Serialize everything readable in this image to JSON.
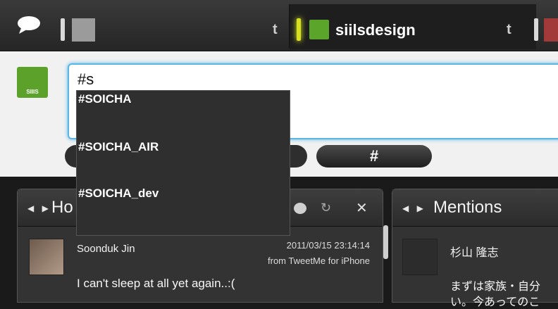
{
  "top": {
    "account_name": "siilsdesign",
    "twitter_glyph": "t",
    "icons": [
      "chat-icon",
      "twitter-icon"
    ]
  },
  "compose": {
    "logo_text": "SIIIS",
    "input_value": "#s",
    "hash_button": "#"
  },
  "autocomplete": {
    "items": [
      "#SOICHA",
      "#SOICHA_AIR",
      "#SOICHA_dev"
    ]
  },
  "home_panel": {
    "title": "Ho",
    "arrows": "◀ ▶",
    "refresh_icon": "↻",
    "close_icon": "✕",
    "tweet": {
      "user": "Soonduk Jin",
      "datetime": "2011/03/15 23:14:14",
      "source": "from TweetMe for iPhone",
      "text": "I can't sleep at all yet again..:("
    }
  },
  "mentions_panel": {
    "title": "Mentions",
    "arrows": "◀ ▶",
    "tweet": {
      "user": "杉山 隆志",
      "text_line1": "まずは家族・自分",
      "text_line2": "い。今あってのこ"
    }
  }
}
